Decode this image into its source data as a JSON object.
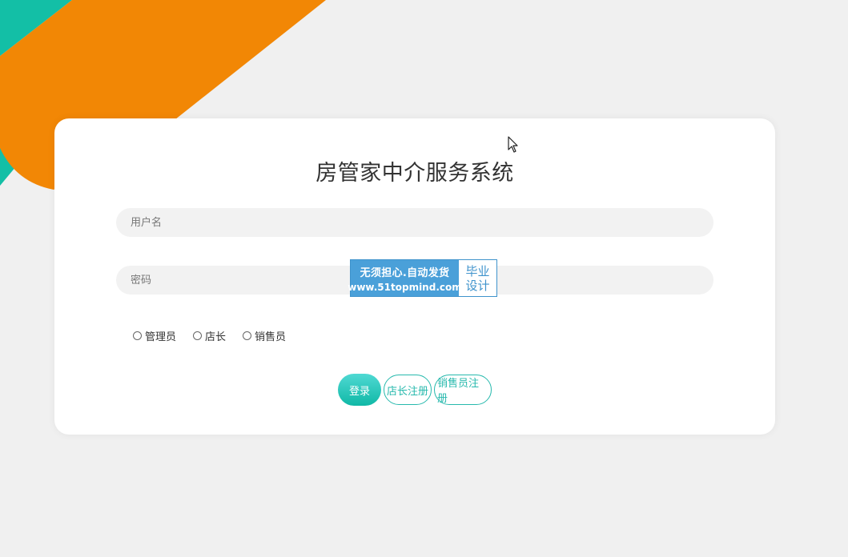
{
  "title": "房管家中介服务系统",
  "form": {
    "username_placeholder": "用户名",
    "password_placeholder": "密码",
    "roles": [
      {
        "label": "管理员",
        "selected": false
      },
      {
        "label": "店长",
        "selected": false
      },
      {
        "label": "销售员",
        "selected": false
      }
    ],
    "buttons": {
      "login": "登录",
      "shop_register": "店长注册",
      "sales_register": "销售员注册"
    }
  },
  "watermark": {
    "line1": "无须担心.自动发货",
    "line2": "www.51topmind.com",
    "right_line1": "毕业",
    "right_line2": "设计"
  },
  "colors": {
    "teal_accent": "#27b9ad",
    "orange_decor": "#f28705",
    "teal_decor": "#13bfa6",
    "background": "#f0f0f0"
  },
  "icons": {
    "cursor": "mouse-pointer-icon"
  }
}
